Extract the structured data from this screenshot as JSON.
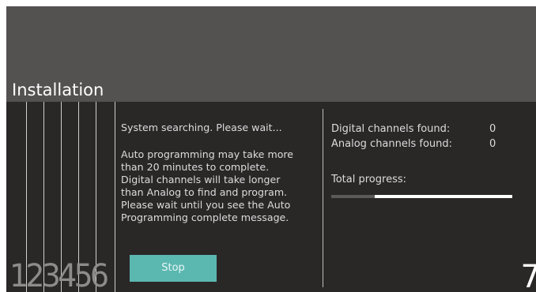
{
  "header": {
    "title": "Installation"
  },
  "steps": {
    "numbers": "123456",
    "current": "7"
  },
  "main": {
    "status": "System searching. Please wait...",
    "info": "Auto programming may take more\nthan 20 minutes to complete.\nDigital channels will take longer\nthan Analog to find and program.\nPlease wait until you see the Auto\nProgramming complete message.",
    "stop_label": "Stop"
  },
  "results": {
    "digital_label": "Digital channels found:",
    "digital_count": "0",
    "analog_label": "Analog channels found:",
    "analog_count": "0",
    "progress_label": "Total progress:",
    "progress_fraction": 0.24
  },
  "colors": {
    "header_bg": "#545151",
    "panel_bg": "#2a2727",
    "accent_button": "#5bb8b1"
  }
}
